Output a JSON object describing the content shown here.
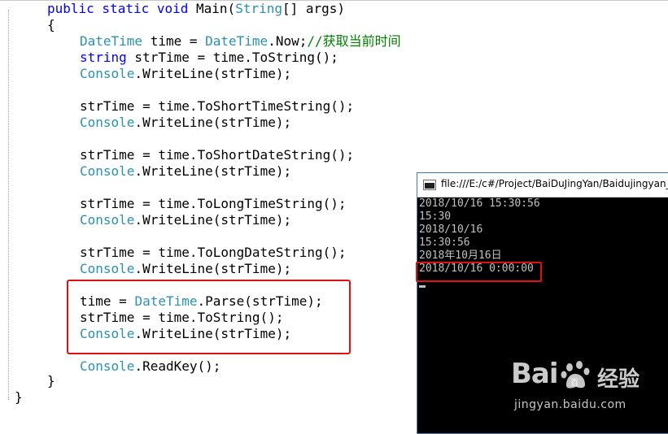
{
  "code": {
    "line_main": {
      "kw": "public static void",
      "name": " Main(",
      "type": "String",
      "rest": "[] args)"
    },
    "brace_open": "{",
    "line_datetime": {
      "type1": "DateTime",
      "mid": " time = ",
      "type2": "DateTime",
      "rest": ".Now;",
      "comment": "//获取当前时间"
    },
    "line_string": {
      "kw": "string",
      "rest": " strTime = time.ToString();"
    },
    "console_type": "Console",
    "writeline": ".WriteLine(strTime);",
    "line_short_time": "strTime = time.ToShortTimeString();",
    "line_short_date": "strTime = time.ToShortDateString();",
    "line_long_time": "strTime = time.ToLongTimeString();",
    "line_long_date": "strTime = time.ToLongDateString();",
    "line_parse": {
      "pre": "time = ",
      "type": "DateTime",
      "rest": ".Parse(strTime);"
    },
    "line_tostring": "strTime = time.ToString();",
    "readkey": ".ReadKey();",
    "brace_close_inner": "}",
    "brace_close_outer": "}"
  },
  "console": {
    "title": "file:///E:/c#/Project/BaiDuJingYan/Baidujingyan_",
    "output": [
      "2018/10/16 15:30:56",
      "15:30",
      "2018/10/16",
      "15:30:56",
      "2018年10月16日",
      "2018/10/16 0:00:00"
    ]
  },
  "watermark": {
    "brand": "Bai",
    "brand_suffix": "百",
    "product": "经验",
    "url": "jingyan.baidu.com"
  },
  "colors": {
    "keyword": "#0000ff",
    "type": "#2b91af",
    "comment": "#008000",
    "highlight": "#e01010",
    "console_bg": "#000000",
    "console_text": "#c0c0c0"
  }
}
